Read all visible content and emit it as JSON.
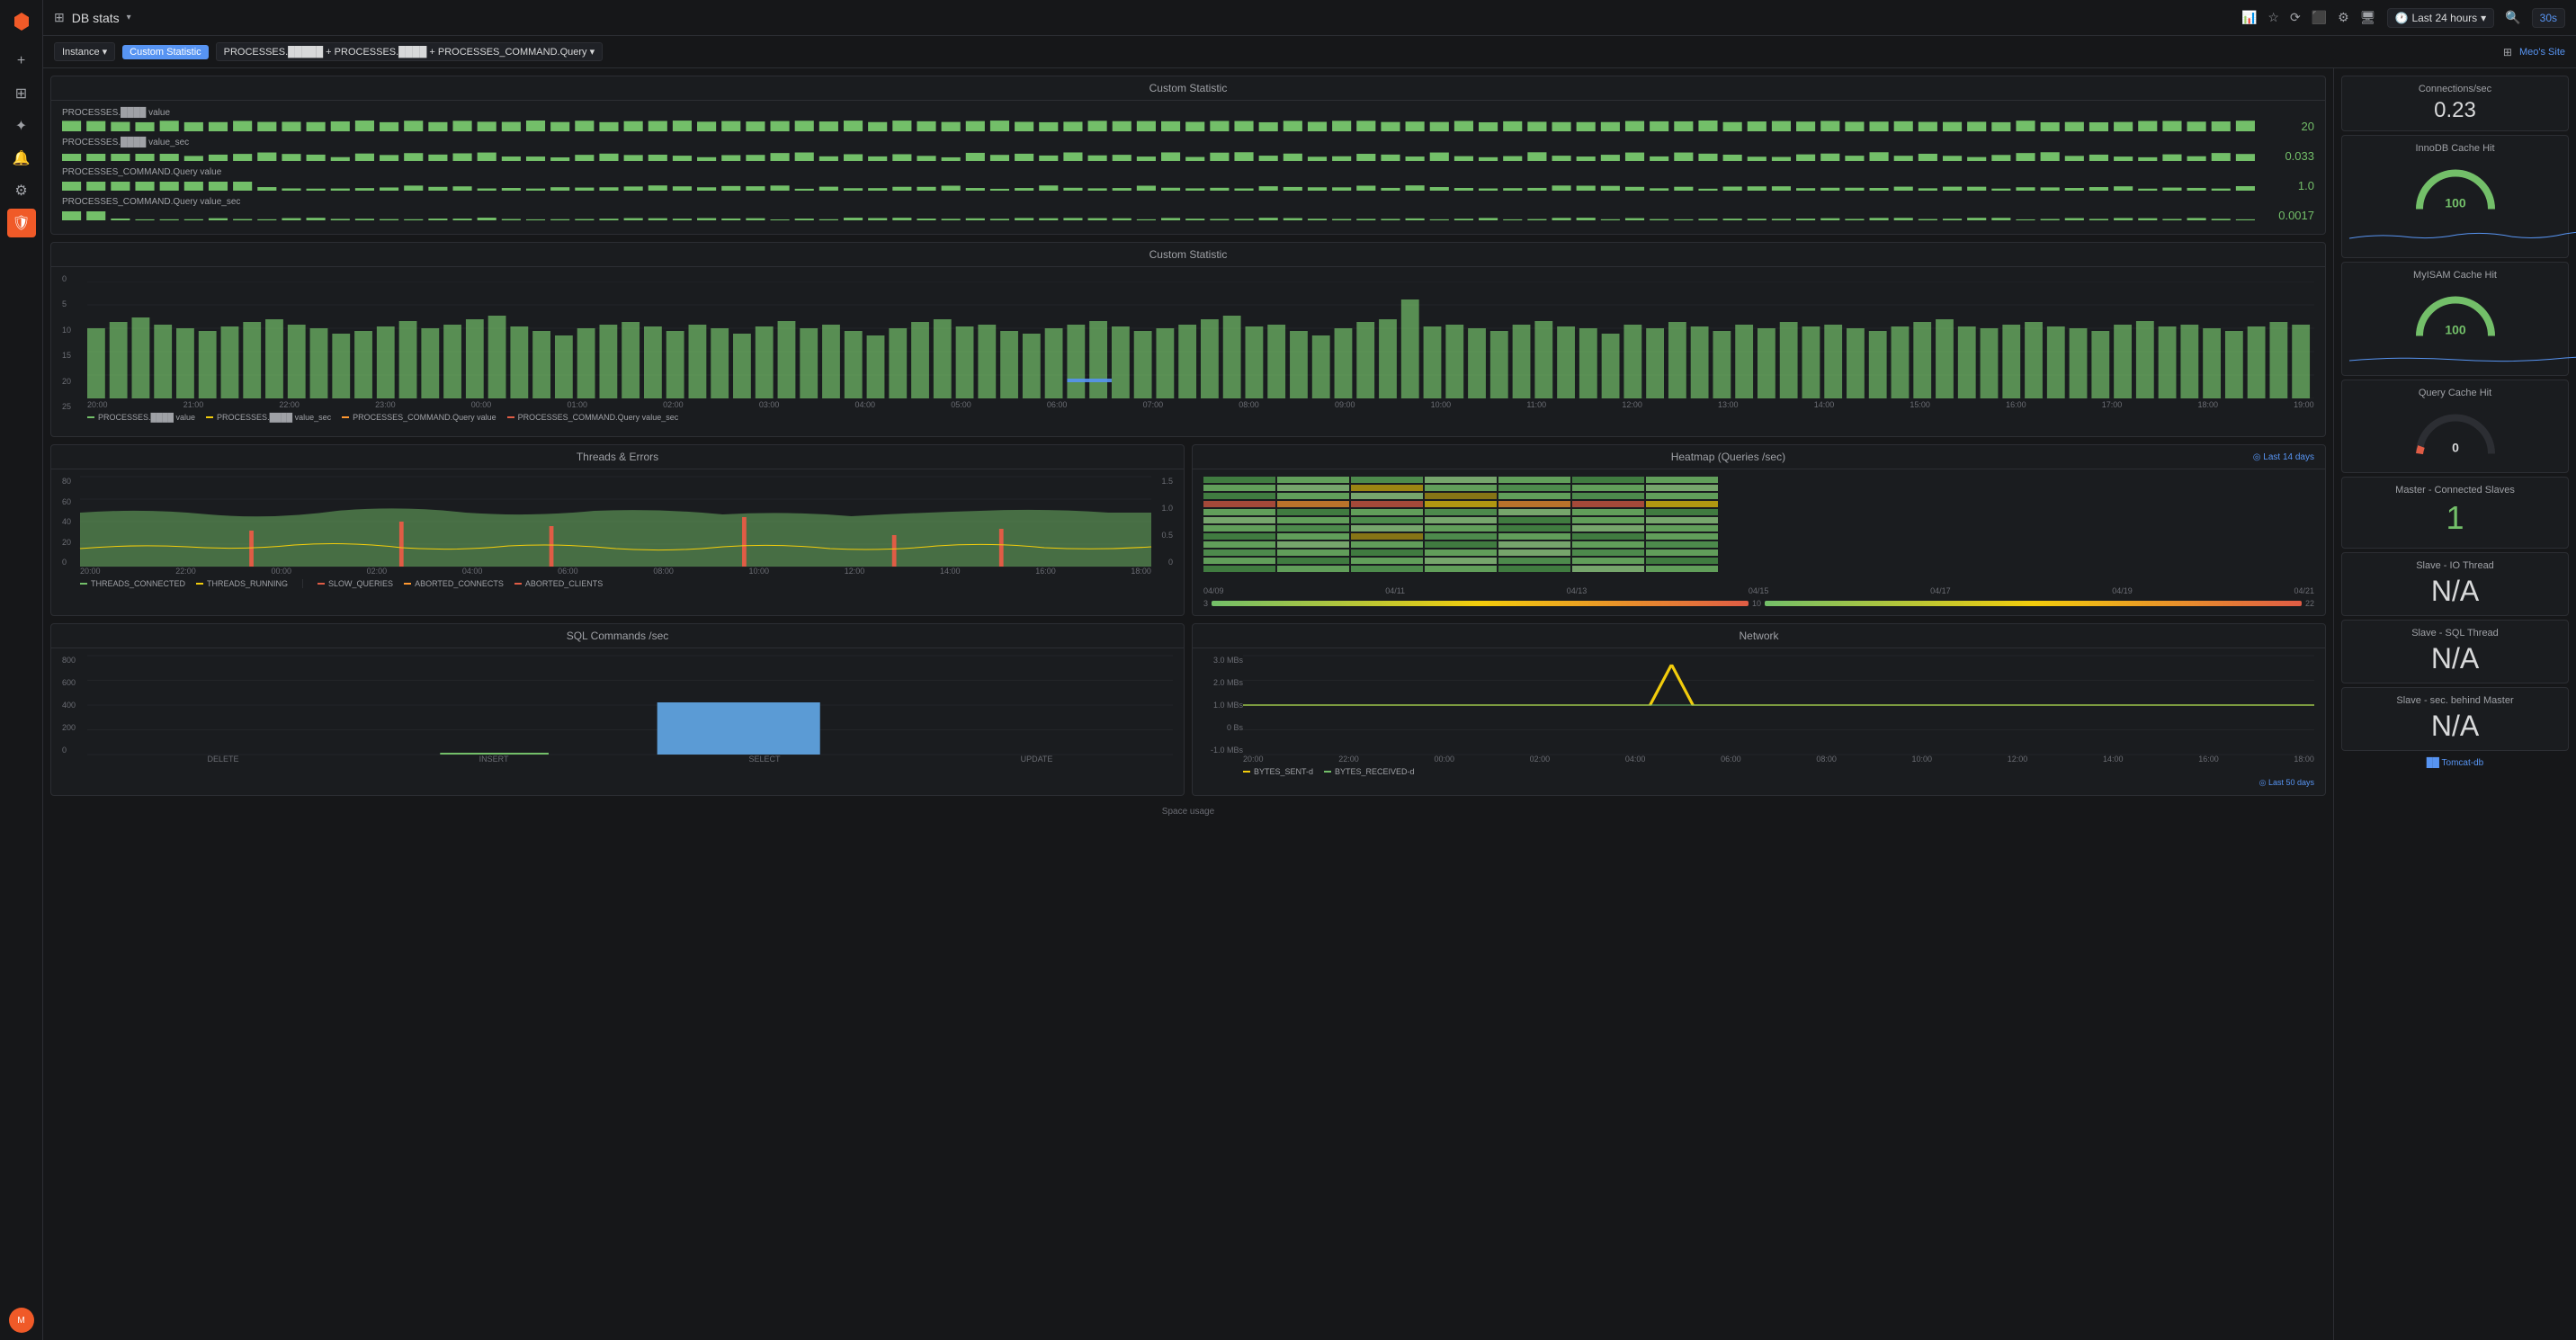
{
  "sidebar": {
    "logo": "⬡",
    "items": [
      {
        "name": "plus",
        "icon": "+",
        "active": false
      },
      {
        "name": "grid",
        "icon": "⊞",
        "active": false
      },
      {
        "name": "explore",
        "icon": "✦",
        "active": false
      },
      {
        "name": "bell",
        "icon": "🔔",
        "active": false
      },
      {
        "name": "gear",
        "icon": "⚙",
        "active": false
      },
      {
        "name": "shield",
        "icon": "⛉",
        "active": true
      }
    ],
    "avatar": "👤"
  },
  "topnav": {
    "grid_icon": "⊞",
    "title": "DB stats",
    "arrow": "▾",
    "icons": [
      "📊",
      "★",
      "⟳",
      "⬛",
      "⚙",
      "🖥"
    ],
    "time_label": "Last 24 hours",
    "refresh_label": "30s"
  },
  "subheader": {
    "dropdown_label": "Instance ▾",
    "badge_label": "Custom Statistic",
    "query_path": "PROCESSES.█████ + PROCESSES.████ + PROCESSES_COMMAND.Query ▾",
    "right": {
      "grid_icon": "⊞",
      "site_link": "Meo's Site"
    }
  },
  "custom_statistic_panel1": {
    "title": "Custom Statistic",
    "rows": [
      {
        "label": "PROCESSES.████ value",
        "value": "20"
      },
      {
        "label": "PROCESSES.████ value_sec",
        "value": "0.033"
      },
      {
        "label": "PROCESSES_COMMAND.Query value",
        "value": "1.0"
      },
      {
        "label": "PROCESSES_COMMAND.Query value_sec",
        "value": "0.0017"
      }
    ]
  },
  "custom_statistic_panel2": {
    "title": "Custom Statistic",
    "yaxis": [
      "0",
      "5",
      "10",
      "15",
      "20",
      "25"
    ],
    "xaxis": [
      "20:00",
      "21:00",
      "22:00",
      "23:00",
      "00:00",
      "01:00",
      "02:00",
      "03:00",
      "04:00",
      "05:00",
      "06:00",
      "07:00",
      "08:00",
      "09:00",
      "10:00",
      "11:00",
      "12:00",
      "13:00",
      "14:00",
      "15:00",
      "16:00",
      "17:00",
      "18:00",
      "19:00"
    ],
    "legend": [
      {
        "label": "PROCESSES.████ value",
        "color": "#73bf69"
      },
      {
        "label": "PROCESSES.████ value_sec",
        "color": "#f2cc0c"
      },
      {
        "label": "PROCESSES_COMMAND.Query value",
        "color": "#ff9830"
      },
      {
        "label": "PROCESSES_COMMAND.Query value_sec",
        "color": "#e05c45"
      }
    ]
  },
  "threads_panel": {
    "title": "Threads & Errors",
    "yaxis_left": [
      "0",
      "20",
      "40",
      "60",
      "80"
    ],
    "yaxis_right": [
      "0",
      "0.5",
      "1.0",
      "1.5"
    ],
    "xaxis": [
      "20:00",
      "22:00",
      "00:00",
      "02:00",
      "04:00",
      "06:00",
      "08:00",
      "10:00",
      "12:00",
      "14:00",
      "16:00",
      "18:00"
    ],
    "legend_left": [
      {
        "label": "THREADS_CONNECTED",
        "color": "#73bf69"
      },
      {
        "label": "THREADS_RUNNING",
        "color": "#f2cc0c"
      }
    ],
    "legend_right": [
      {
        "label": "SLOW_QUERIES",
        "color": "#e05c45"
      },
      {
        "label": "ABORTED_CONNECTS",
        "color": "#ff9830"
      },
      {
        "label": "ABORTED_CLIENTS",
        "color": "#e05c45"
      }
    ]
  },
  "heatmap_panel": {
    "title": "Heatmap (Queries /sec)",
    "date_badge": "◎ Last 14 days",
    "xaxis": [
      "04/09",
      "04/11",
      "04/13",
      "04/15",
      "04/17",
      "04/19",
      "04/21"
    ],
    "legend_min": "3",
    "legend_mid": "10",
    "legend_max": "22"
  },
  "sql_panel": {
    "title": "SQL Commands /sec",
    "yaxis": [
      "0",
      "200",
      "400",
      "600",
      "800"
    ],
    "xaxis": [
      "DELETE",
      "INSERT",
      "SELECT",
      "UPDATE"
    ],
    "bars": [
      {
        "label": "DELETE",
        "value": 0,
        "color": "#1f77b4"
      },
      {
        "label": "INSERT",
        "value": 15,
        "color": "#73bf69"
      },
      {
        "label": "SELECT",
        "value": 420,
        "color": "#5b9bd5"
      },
      {
        "label": "UPDATE",
        "value": 0,
        "color": "#1f77b4"
      }
    ]
  },
  "network_panel": {
    "title": "Network",
    "yaxis": [
      "-1.0 MBs",
      "0 Bs",
      "1.0 MBs",
      "2.0 MBs",
      "3.0 MBs"
    ],
    "xaxis": [
      "20:00",
      "22:00",
      "00:00",
      "02:00",
      "04:00",
      "06:00",
      "08:00",
      "10:00",
      "12:00",
      "14:00",
      "16:00",
      "18:00"
    ],
    "legend": [
      {
        "label": "BYTES_SENT-d",
        "color": "#f2cc0c"
      },
      {
        "label": "BYTES_RECEIVED-d",
        "color": "#73bf69"
      }
    ],
    "date_badge": "◎ Last 50 days"
  },
  "right_widgets": {
    "connections": {
      "title": "Connections/sec",
      "value": "0.23"
    },
    "innodb": {
      "title": "InnoDB Cache Hit",
      "value": "100"
    },
    "myisam": {
      "title": "MyISAM Cache Hit",
      "value": "100"
    },
    "query_cache": {
      "title": "Query Cache Hit",
      "value": "0"
    },
    "master_slaves": {
      "title": "Master - Connected Slaves",
      "value": "1"
    },
    "slave_io": {
      "title": "Slave - IO Thread",
      "value": "N/A"
    },
    "slave_sql": {
      "title": "Slave - SQL Thread",
      "value": "N/A"
    },
    "slave_behind": {
      "title": "Slave - sec. behind Master",
      "value": "N/A"
    },
    "footer_link": "██ Tomcat-db"
  }
}
